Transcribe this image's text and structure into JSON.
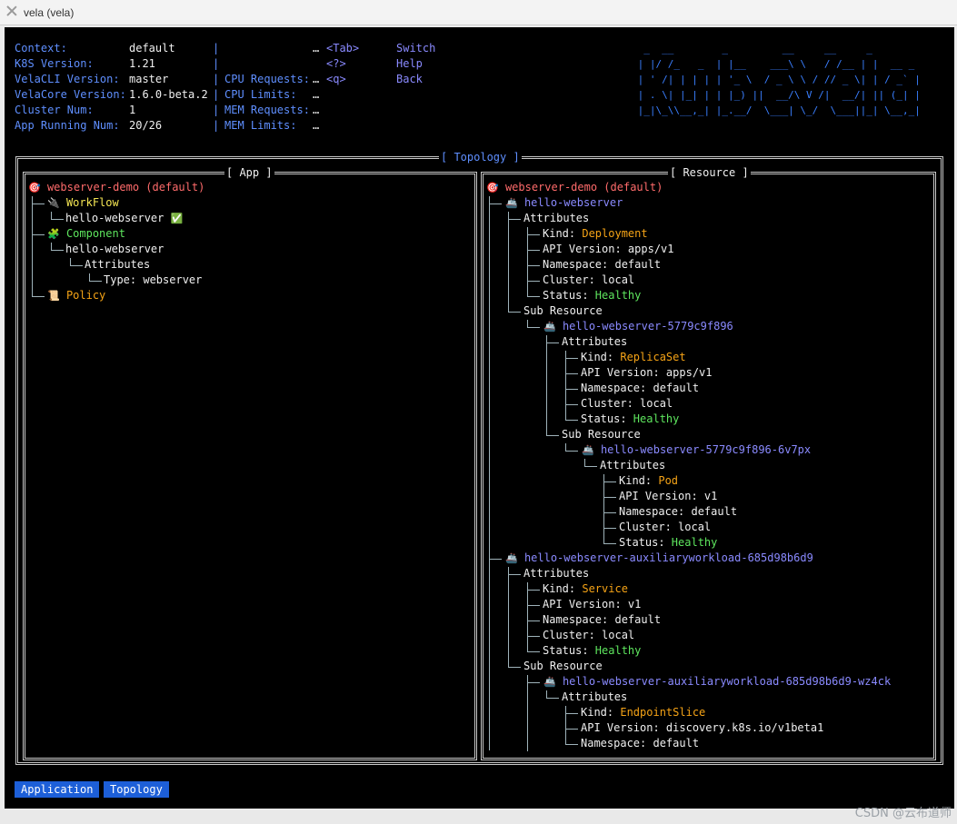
{
  "window": {
    "title": "vela (vela)"
  },
  "header": {
    "info": [
      {
        "label": "Context:",
        "value": "default"
      },
      {
        "label": "K8S Version:",
        "value": "1.21"
      },
      {
        "label": "VelaCLI Version:",
        "value": "master"
      },
      {
        "label": "VelaCore Version:",
        "value": "1.6.0-beta.2"
      },
      {
        "label": "Cluster Num:",
        "value": "1"
      },
      {
        "label": "App Running Num:",
        "value": "20/26"
      }
    ],
    "sep": "|",
    "resources": [
      {
        "label": "",
        "value": "…"
      },
      {
        "label": "",
        "value": ""
      },
      {
        "label": "CPU Requests:",
        "value": "…"
      },
      {
        "label": "CPU Limits:",
        "value": "…"
      },
      {
        "label": "MEM Requests:",
        "value": "…"
      },
      {
        "label": "MEM Limits:",
        "value": "…"
      }
    ],
    "keys": [
      {
        "key": "<Tab>",
        "action": "Switch"
      },
      {
        "key": "<?>",
        "action": "Help"
      },
      {
        "key": "<q>",
        "action": "Back"
      }
    ],
    "logo": [
      "  _  __        _         __     __     _",
      " | |/ /_   _  | |__    ___\\ \\   / /__ | |  __ _",
      " | ' /| | | | | '_ \\  / _ \\ \\ / // _ \\| | / _` |",
      " | . \\| |_| | | |_) ||  __/\\ V /|  __/| || (_| |",
      " |_|\\_\\\\__,_| |_.__/  \\___| \\_/  \\___||_| \\__,_|"
    ]
  },
  "topology": {
    "title": "[ Topology ]",
    "app_panel": {
      "title": "[ App ]",
      "root": "webserver-demo (default)",
      "workflow": "WorkFlow",
      "workflow_child": "hello-webserver",
      "workflow_status_icon": "check-icon",
      "component": "Component",
      "component_child": "hello-webserver",
      "attributes": "Attributes",
      "type_line": "Type: webserver",
      "policy": "Policy"
    },
    "resource_panel": {
      "title": "[ Resource ]",
      "root": "webserver-demo (default)",
      "attributes_label": "Attributes",
      "sub_resource_label": "Sub Resource",
      "k_kind": "Kind: ",
      "k_api": "API Version: ",
      "k_ns": "Namespace: ",
      "k_cluster": "Cluster: ",
      "k_status": "Status: ",
      "r1": {
        "name": "hello-webserver",
        "kind": "Deployment",
        "api": "apps/v1",
        "ns": "default",
        "cluster": "local",
        "status": "Healthy"
      },
      "r1_1": {
        "name": "hello-webserver-5779c9f896",
        "kind": "ReplicaSet",
        "api": "apps/v1",
        "ns": "default",
        "cluster": "local",
        "status": "Healthy"
      },
      "r1_1_1": {
        "name": "hello-webserver-5779c9f896-6v7px",
        "kind": "Pod",
        "api": "v1",
        "ns": "default",
        "cluster": "local",
        "status": "Healthy"
      },
      "r2": {
        "name": "hello-webserver-auxiliaryworkload-685d98b6d9",
        "kind": "Service",
        "api": "v1",
        "ns": "default",
        "cluster": "local",
        "status": "Healthy"
      },
      "r2_1": {
        "name": "hello-webserver-auxiliaryworkload-685d98b6d9-wz4ck",
        "kind": "EndpointSlice",
        "api": "discovery.k8s.io/v1beta1",
        "ns": "default"
      }
    }
  },
  "footer": {
    "tabs": [
      "Application",
      "Topology"
    ]
  },
  "watermark": "CSDN @云布道师"
}
